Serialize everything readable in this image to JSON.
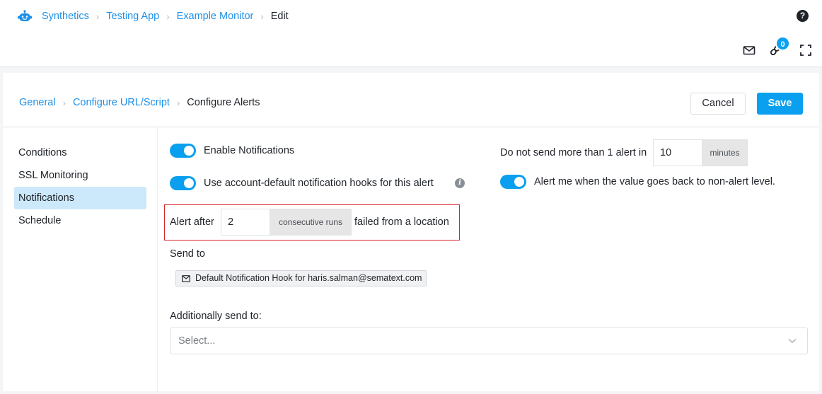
{
  "header": {
    "logo_icon": "robot-icon",
    "breadcrumb": [
      {
        "label": "Synthetics",
        "link": true
      },
      {
        "label": "Testing App",
        "link": true
      },
      {
        "label": "Example Monitor",
        "link": true
      },
      {
        "label": "Edit",
        "link": false
      }
    ],
    "help_icon": "?",
    "notification_badge": "0",
    "icons": [
      "mail-icon",
      "link-icon",
      "expand-icon"
    ]
  },
  "card": {
    "steps": [
      {
        "label": "General",
        "link": true
      },
      {
        "label": "Configure URL/Script",
        "link": true
      },
      {
        "label": "Configure Alerts",
        "link": false
      }
    ],
    "cancel_label": "Cancel",
    "save_label": "Save",
    "sidenav": [
      {
        "label": "Conditions",
        "active": false
      },
      {
        "label": "SSL Monitoring",
        "active": false
      },
      {
        "label": "Notifications",
        "active": true
      },
      {
        "label": "Schedule",
        "active": false
      }
    ],
    "notifications": {
      "enable_notifications": {
        "label": "Enable Notifications",
        "on": true
      },
      "use_default_hooks": {
        "label": "Use account-default notification hooks for this alert",
        "on": true,
        "info_icon": "i"
      },
      "alert_after": {
        "prefix": "Alert after",
        "value": "2",
        "addon": "consecutive runs",
        "suffix": "failed from a location"
      },
      "send_to": {
        "label": "Send to",
        "hooks": [
          "Default Notification Hook for haris.salman@sematext.com"
        ]
      },
      "additionally_send_to": {
        "label": "Additionally send to:",
        "placeholder": "Select..."
      },
      "throttle": {
        "prefix": "Do not send more than 1 alert in",
        "value": "10",
        "addon": "minutes"
      },
      "alert_on_recovery": {
        "label": "Alert me when the value goes back to non-alert level.",
        "on": true
      }
    }
  },
  "colors": {
    "accent": "#0aa0ef",
    "link": "#1e90e8",
    "active_nav": "#cce8fb",
    "highlight_border": "#d7262d"
  }
}
